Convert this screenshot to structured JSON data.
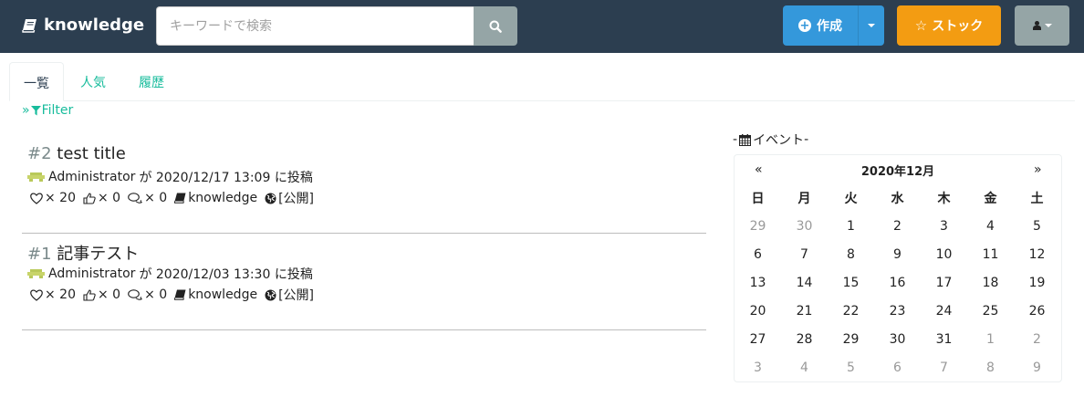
{
  "nav": {
    "brand": "knowledge",
    "search_placeholder": "キーワードで検索",
    "create_label": "作成",
    "stock_label": "ストック"
  },
  "tabs": [
    {
      "label": "一覧",
      "active": true
    },
    {
      "label": "人気",
      "active": false
    },
    {
      "label": "履歴",
      "active": false
    }
  ],
  "filter_label": "Filter",
  "articles": [
    {
      "number": "#2",
      "title": "test title",
      "author": "Administrator",
      "meta_rest": "が 2020/12/17 13:09 に投稿",
      "likes": "× 20",
      "thumbs": "× 0",
      "comments": "× 0",
      "category": "knowledge",
      "visibility": "[公開]"
    },
    {
      "number": "#1",
      "title": "記事テスト",
      "author": "Administrator",
      "meta_rest": "が 2020/12/03 13:30 に投稿",
      "likes": "× 20",
      "thumbs": "× 0",
      "comments": "× 0",
      "category": "knowledge",
      "visibility": "[公開]"
    }
  ],
  "events": {
    "heading": "イベント",
    "heading_prefix": "-",
    "heading_suffix": "-",
    "prev": "«",
    "next": "»",
    "month": "2020年12月",
    "weekdays": [
      "日",
      "月",
      "火",
      "水",
      "木",
      "金",
      "土"
    ],
    "weeks": [
      [
        "29",
        "30",
        "1",
        "2",
        "3",
        "4",
        "5"
      ],
      [
        "6",
        "7",
        "8",
        "9",
        "10",
        "11",
        "12"
      ],
      [
        "13",
        "14",
        "15",
        "16",
        "17",
        "18",
        "19"
      ],
      [
        "20",
        "21",
        "22",
        "23",
        "24",
        "25",
        "26"
      ],
      [
        "27",
        "28",
        "29",
        "30",
        "31",
        "1",
        "2"
      ],
      [
        "3",
        "4",
        "5",
        "6",
        "7",
        "8",
        "9"
      ]
    ],
    "other_month_flags": [
      [
        true,
        true,
        false,
        false,
        false,
        false,
        false
      ],
      [
        false,
        false,
        false,
        false,
        false,
        false,
        false
      ],
      [
        false,
        false,
        false,
        false,
        false,
        false,
        false
      ],
      [
        false,
        false,
        false,
        false,
        false,
        false,
        false
      ],
      [
        false,
        false,
        false,
        false,
        false,
        true,
        true
      ],
      [
        true,
        true,
        true,
        true,
        true,
        true,
        true
      ]
    ]
  },
  "colors": {
    "navbar": "#2c3e50",
    "primary": "#3498db",
    "warning": "#f39c12",
    "default": "#95a5a6",
    "link": "#18bc9c",
    "muted": "#999999"
  },
  "icons": {
    "brand": "book-icon",
    "search": "search-icon",
    "create": "plus-circle-icon",
    "stock": "star-icon",
    "user": "user-icon",
    "filter": "filter-icon",
    "like": "heart-icon",
    "thumbs": "thumbs-up-icon",
    "comments": "comments-icon",
    "category": "book-icon",
    "visibility": "globe-icon",
    "calendar": "calendar-icon"
  }
}
